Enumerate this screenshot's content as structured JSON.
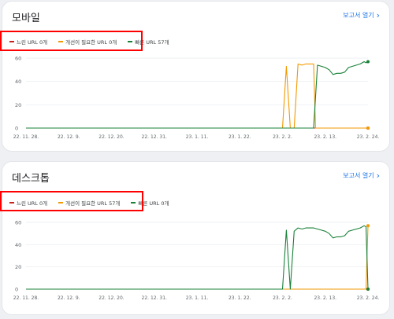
{
  "sections": [
    {
      "title": "모바일",
      "report_link": "보고서 열기",
      "legend": [
        {
          "label": "느린 URL 0개",
          "color": "#c5221f"
        },
        {
          "label": "개선이 필요한 URL 0개",
          "color": "#f29900"
        },
        {
          "label": "빠른 URL 57개",
          "color": "#188038"
        }
      ]
    },
    {
      "title": "데스크톱",
      "report_link": "보고서 열기",
      "legend": [
        {
          "label": "느린 URL 0개",
          "color": "#c5221f"
        },
        {
          "label": "개선이 필요한 URL 57개",
          "color": "#f29900"
        },
        {
          "label": "빠른 URL 0개",
          "color": "#188038"
        }
      ]
    }
  ],
  "chart_data": [
    {
      "type": "line",
      "x": [
        "22. 11. 28.",
        "22. 12. 9.",
        "22. 12. 20.",
        "22. 12. 31.",
        "23. 1. 11.",
        "23. 1. 22.",
        "23. 2. 2.",
        "23. 2. 13.",
        "23. 2. 24."
      ],
      "ylim": [
        0,
        60
      ],
      "yticks": [
        0,
        20,
        40,
        60
      ],
      "series": [
        {
          "name": "느린 URL 0개",
          "color": "#c5221f",
          "points": [
            [
              0,
              0
            ],
            [
              88,
              0
            ]
          ]
        },
        {
          "name": "개선이 필요한 URL 0개",
          "color": "#f29900",
          "points": [
            [
              0,
              0
            ],
            [
              66,
              0
            ],
            [
              67,
              53
            ],
            [
              68,
              0
            ],
            [
              69,
              0
            ],
            [
              70,
              55
            ],
            [
              71,
              54
            ],
            [
              72,
              55
            ],
            [
              73,
              55
            ],
            [
              74,
              55
            ],
            [
              74.5,
              0
            ],
            [
              88,
              0
            ]
          ]
        },
        {
          "name": "빠른 URL 57개",
          "color": "#188038",
          "points": [
            [
              0,
              0
            ],
            [
              74,
              0
            ],
            [
              75,
              54
            ],
            [
              76,
              53
            ],
            [
              77,
              52
            ],
            [
              78,
              50
            ],
            [
              79,
              46
            ],
            [
              80,
              47
            ],
            [
              81,
              47
            ],
            [
              82,
              48
            ],
            [
              83,
              52
            ],
            [
              84,
              53
            ],
            [
              85,
              54
            ],
            [
              86,
              55
            ],
            [
              87,
              57
            ],
            [
              87.5,
              56
            ],
            [
              88,
              57
            ]
          ]
        }
      ]
    },
    {
      "type": "line",
      "x": [
        "22. 11. 28.",
        "22. 12. 9.",
        "22. 12. 20.",
        "22. 12. 31.",
        "23. 1. 11.",
        "23. 1. 22.",
        "23. 2. 2.",
        "23. 2. 13.",
        "23. 2. 24."
      ],
      "ylim": [
        0,
        60
      ],
      "yticks": [
        0,
        20,
        40,
        60
      ],
      "series": [
        {
          "name": "느린 URL 0개",
          "color": "#c5221f",
          "points": [
            [
              0,
              0
            ],
            [
              88,
              0
            ]
          ]
        },
        {
          "name": "개선이 필요한 URL 57개",
          "color": "#f29900",
          "points": [
            [
              0,
              0
            ],
            [
              87.5,
              0
            ],
            [
              88,
              57
            ]
          ]
        },
        {
          "name": "빠른 URL 0개",
          "color": "#188038",
          "points": [
            [
              0,
              0
            ],
            [
              66,
              0
            ],
            [
              67,
              53
            ],
            [
              68,
              0
            ],
            [
              69,
              52
            ],
            [
              70,
              55
            ],
            [
              71,
              54
            ],
            [
              72,
              55
            ],
            [
              73,
              55
            ],
            [
              74,
              55
            ],
            [
              75,
              54
            ],
            [
              76,
              53
            ],
            [
              77,
              52
            ],
            [
              78,
              50
            ],
            [
              79,
              46
            ],
            [
              80,
              47
            ],
            [
              81,
              47
            ],
            [
              82,
              48
            ],
            [
              83,
              52
            ],
            [
              84,
              53
            ],
            [
              85,
              54
            ],
            [
              86,
              55
            ],
            [
              87,
              57
            ],
            [
              87.5,
              56
            ],
            [
              88,
              0
            ]
          ]
        }
      ]
    }
  ]
}
